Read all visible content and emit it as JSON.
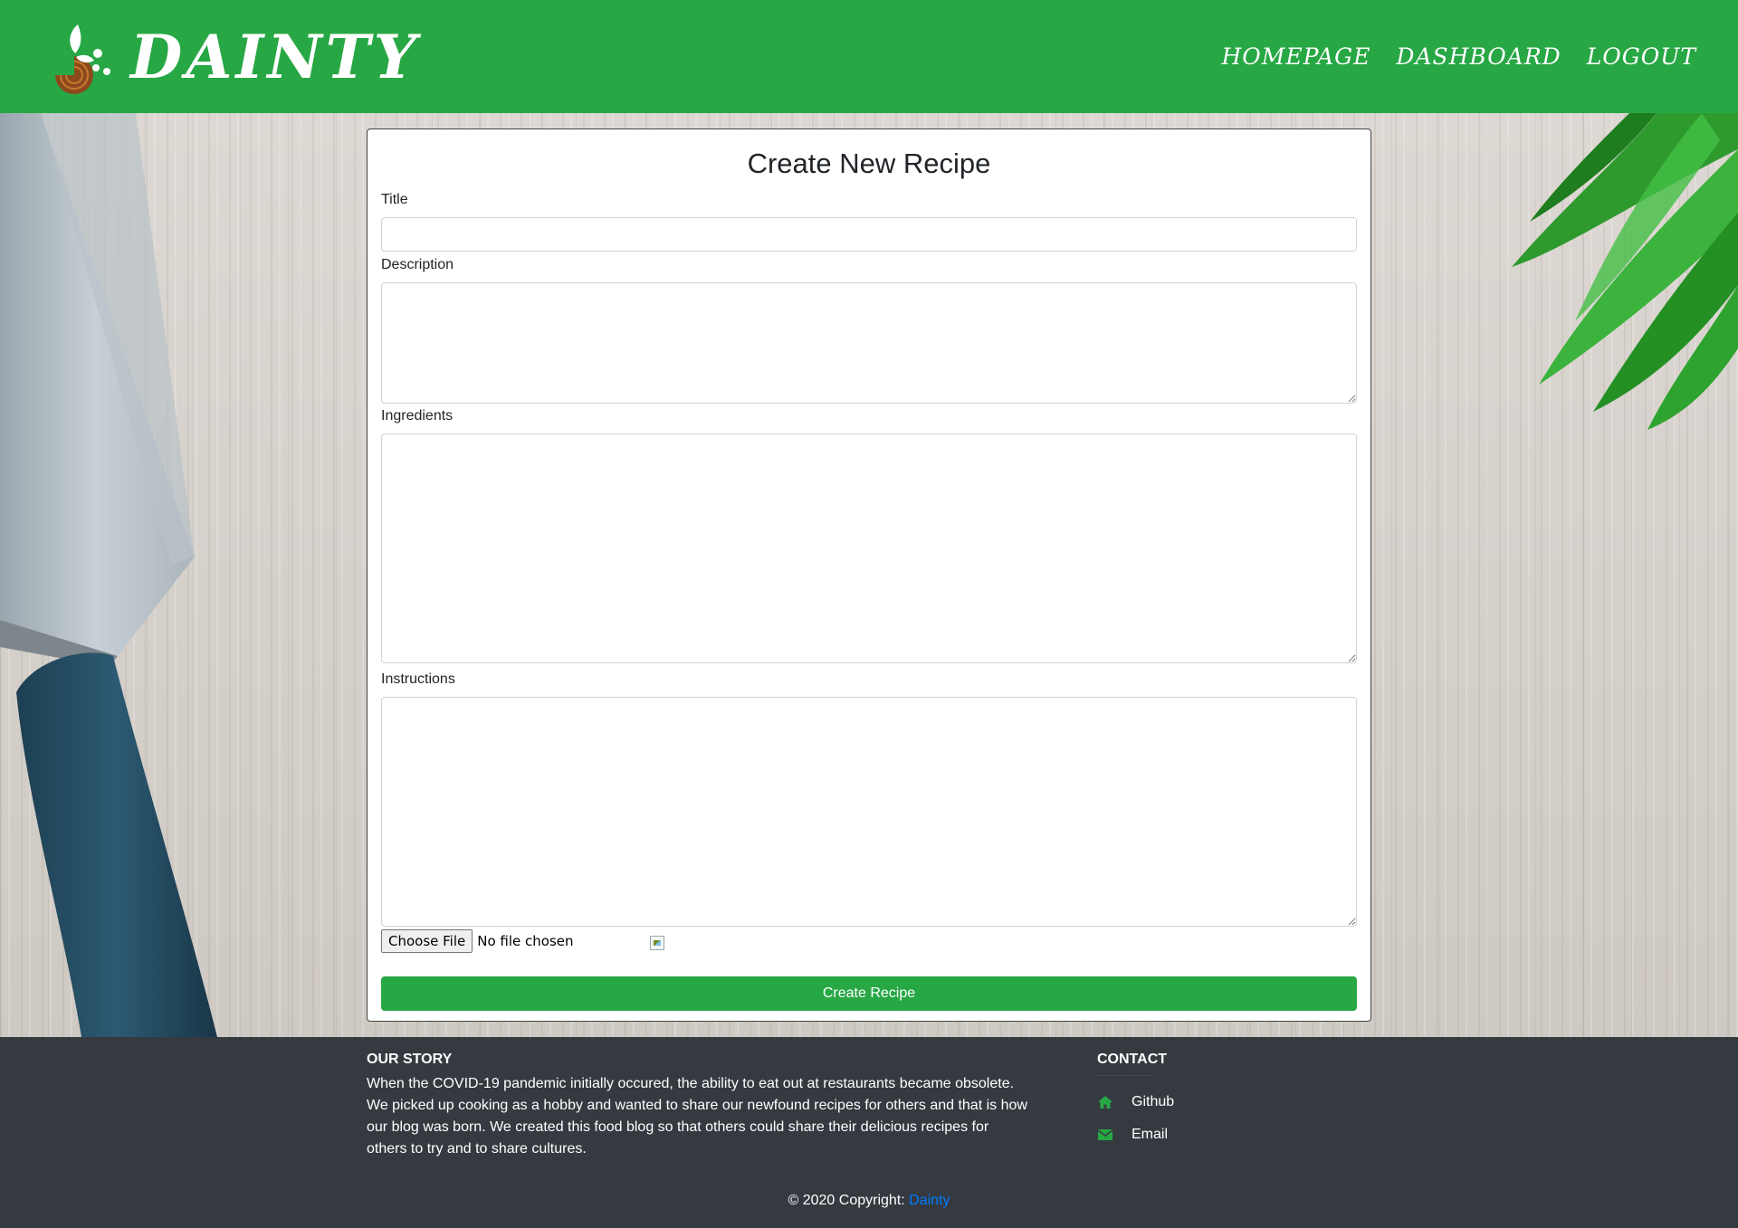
{
  "nav": {
    "brand": "DAINTY",
    "links": [
      "HOMEPAGE",
      "DASHBOARD",
      "LOGOUT"
    ]
  },
  "form": {
    "heading": "Create New Recipe",
    "title_label": "Title",
    "title_value": "",
    "description_label": "Description",
    "description_value": "",
    "ingredients_label": "Ingredients",
    "ingredients_value": "",
    "instructions_label": "Instructions",
    "instructions_value": "",
    "file_button": "Choose File",
    "file_status": "No file chosen",
    "submit": "Create Recipe"
  },
  "footer": {
    "story_heading": "OUR STORY",
    "story_text": "When the COVID-19 pandemic initially occured, the ability to eat out at restaurants became obsolete. We picked up cooking as a hobby and wanted to share our newfound recipes for others and that is how our blog was born. We created this food blog so that others could share their delicious recipes for others to try and to share cultures.",
    "contact_heading": "CONTACT",
    "contacts": [
      {
        "label": "Github",
        "icon": "home-icon"
      },
      {
        "label": "Email",
        "icon": "envelope-icon"
      }
    ],
    "copyright_prefix": "© 2020 Copyright: ",
    "copyright_link": "Dainty"
  },
  "colors": {
    "brand_green": "#28a745",
    "footer_bg": "#343a40",
    "link_blue": "#007bff"
  }
}
